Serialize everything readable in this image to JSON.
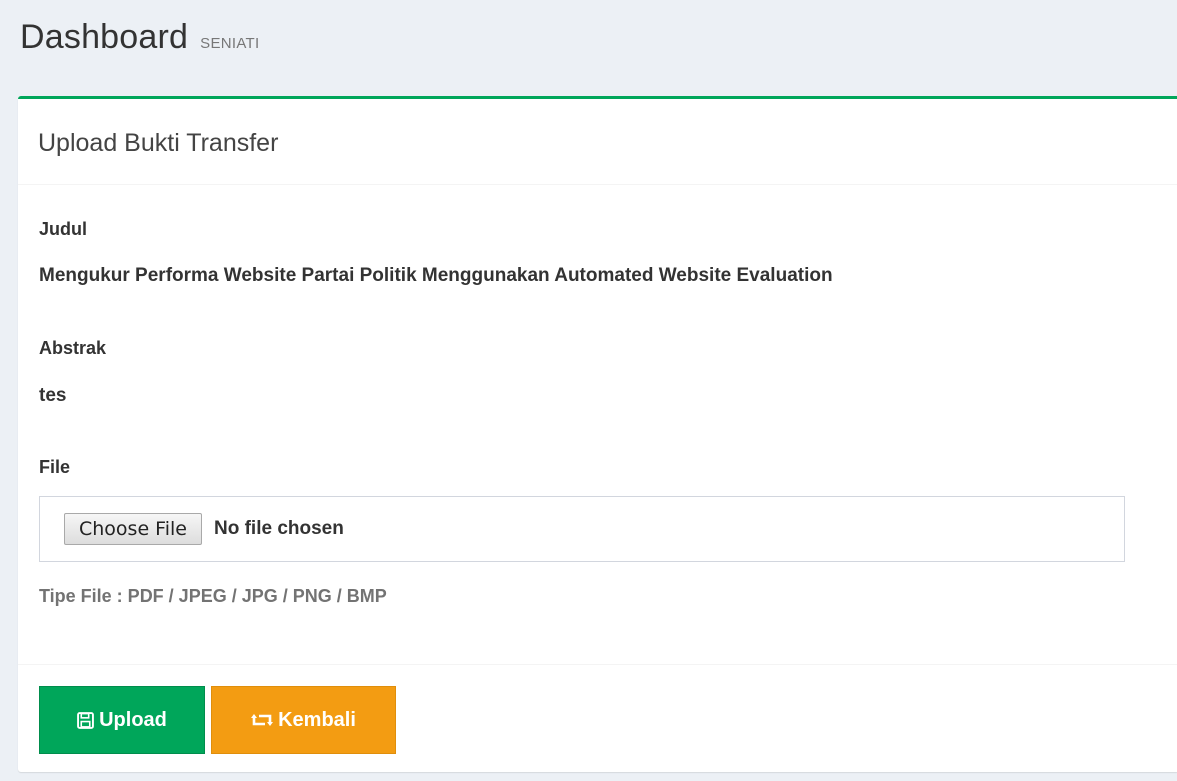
{
  "header": {
    "title": "Dashboard",
    "subtitle": "SENIATI"
  },
  "box": {
    "title": "Upload Bukti Transfer",
    "accent_color": "#00a65a"
  },
  "form": {
    "judul_label": "Judul",
    "judul_value": "Mengukur Performa Website Partai Politik Menggunakan Automated Website Evaluation",
    "abstrak_label": "Abstrak",
    "abstrak_value": "tes",
    "file_label": "File",
    "choose_file_label": "Choose File",
    "file_status": "No file chosen",
    "file_help": "Tipe File : PDF / JPEG / JPG / PNG / BMP"
  },
  "actions": {
    "upload_label": "Upload",
    "upload_icon": "save-icon",
    "upload_color": "#00a65a",
    "back_label": "Kembali",
    "back_icon": "retweet-icon",
    "back_color": "#f39c12"
  }
}
